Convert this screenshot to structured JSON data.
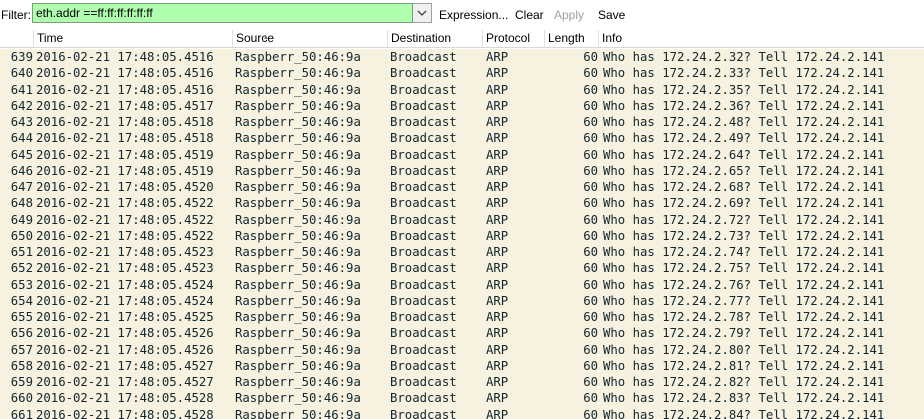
{
  "toolbar": {
    "filter_label": "Filter:",
    "filter_value": "eth.addr ==ff:ff:ff:ff:ff:ff",
    "expression_label": "Expression...",
    "clear_label": "Clear",
    "apply_label": "Apply",
    "save_label": "Save"
  },
  "columns": {
    "no": "",
    "time": "Time",
    "source": "Source",
    "destination": "Destination",
    "protocol": "Protocol",
    "length": "Length",
    "info": "Info"
  },
  "colors": {
    "filter_valid_bg": "#afffaf",
    "row_bg": "#f7f1df",
    "row_text": "#12272e"
  },
  "packets": [
    {
      "no": "639",
      "time": "2016-02-21 17:48:05.4516",
      "source": "Raspberr_50:46:9a",
      "destination": "Broadcast",
      "protocol": "ARP",
      "length": "60",
      "info": "Who has 172.24.2.32?  Tell 172.24.2.141"
    },
    {
      "no": "640",
      "time": "2016-02-21 17:48:05.4516",
      "source": "Raspberr_50:46:9a",
      "destination": "Broadcast",
      "protocol": "ARP",
      "length": "60",
      "info": "Who has 172.24.2.33?  Tell 172.24.2.141"
    },
    {
      "no": "641",
      "time": "2016-02-21 17:48:05.4516",
      "source": "Raspberr_50:46:9a",
      "destination": "Broadcast",
      "protocol": "ARP",
      "length": "60",
      "info": "Who has 172.24.2.35?  Tell 172.24.2.141"
    },
    {
      "no": "642",
      "time": "2016-02-21 17:48:05.4517",
      "source": "Raspberr_50:46:9a",
      "destination": "Broadcast",
      "protocol": "ARP",
      "length": "60",
      "info": "Who has 172.24.2.36?  Tell 172.24.2.141"
    },
    {
      "no": "643",
      "time": "2016-02-21 17:48:05.4518",
      "source": "Raspberr_50:46:9a",
      "destination": "Broadcast",
      "protocol": "ARP",
      "length": "60",
      "info": "Who has 172.24.2.48?  Tell 172.24.2.141"
    },
    {
      "no": "644",
      "time": "2016-02-21 17:48:05.4518",
      "source": "Raspberr_50:46:9a",
      "destination": "Broadcast",
      "protocol": "ARP",
      "length": "60",
      "info": "Who has 172.24.2.49?  Tell 172.24.2.141"
    },
    {
      "no": "645",
      "time": "2016-02-21 17:48:05.4519",
      "source": "Raspberr_50:46:9a",
      "destination": "Broadcast",
      "protocol": "ARP",
      "length": "60",
      "info": "Who has 172.24.2.64?  Tell 172.24.2.141"
    },
    {
      "no": "646",
      "time": "2016-02-21 17:48:05.4519",
      "source": "Raspberr_50:46:9a",
      "destination": "Broadcast",
      "protocol": "ARP",
      "length": "60",
      "info": "Who has 172.24.2.65?  Tell 172.24.2.141"
    },
    {
      "no": "647",
      "time": "2016-02-21 17:48:05.4520",
      "source": "Raspberr_50:46:9a",
      "destination": "Broadcast",
      "protocol": "ARP",
      "length": "60",
      "info": "Who has 172.24.2.68?  Tell 172.24.2.141"
    },
    {
      "no": "648",
      "time": "2016-02-21 17:48:05.4522",
      "source": "Raspberr_50:46:9a",
      "destination": "Broadcast",
      "protocol": "ARP",
      "length": "60",
      "info": "Who has 172.24.2.69?  Tell 172.24.2.141"
    },
    {
      "no": "649",
      "time": "2016-02-21 17:48:05.4522",
      "source": "Raspberr_50:46:9a",
      "destination": "Broadcast",
      "protocol": "ARP",
      "length": "60",
      "info": "Who has 172.24.2.72?  Tell 172.24.2.141"
    },
    {
      "no": "650",
      "time": "2016-02-21 17:48:05.4522",
      "source": "Raspberr_50:46:9a",
      "destination": "Broadcast",
      "protocol": "ARP",
      "length": "60",
      "info": "Who has 172.24.2.73?  Tell 172.24.2.141"
    },
    {
      "no": "651",
      "time": "2016-02-21 17:48:05.4523",
      "source": "Raspberr_50:46:9a",
      "destination": "Broadcast",
      "protocol": "ARP",
      "length": "60",
      "info": "Who has 172.24.2.74?  Tell 172.24.2.141"
    },
    {
      "no": "652",
      "time": "2016-02-21 17:48:05.4523",
      "source": "Raspberr_50:46:9a",
      "destination": "Broadcast",
      "protocol": "ARP",
      "length": "60",
      "info": "Who has 172.24.2.75?  Tell 172.24.2.141"
    },
    {
      "no": "653",
      "time": "2016-02-21 17:48:05.4524",
      "source": "Raspberr_50:46:9a",
      "destination": "Broadcast",
      "protocol": "ARP",
      "length": "60",
      "info": "Who has 172.24.2.76?  Tell 172.24.2.141"
    },
    {
      "no": "654",
      "time": "2016-02-21 17:48:05.4524",
      "source": "Raspberr_50:46:9a",
      "destination": "Broadcast",
      "protocol": "ARP",
      "length": "60",
      "info": "Who has 172.24.2.77?  Tell 172.24.2.141"
    },
    {
      "no": "655",
      "time": "2016-02-21 17:48:05.4525",
      "source": "Raspberr_50:46:9a",
      "destination": "Broadcast",
      "protocol": "ARP",
      "length": "60",
      "info": "Who has 172.24.2.78?  Tell 172.24.2.141"
    },
    {
      "no": "656",
      "time": "2016-02-21 17:48:05.4526",
      "source": "Raspberr_50:46:9a",
      "destination": "Broadcast",
      "protocol": "ARP",
      "length": "60",
      "info": "Who has 172.24.2.79?  Tell 172.24.2.141"
    },
    {
      "no": "657",
      "time": "2016-02-21 17:48:05.4526",
      "source": "Raspberr_50:46:9a",
      "destination": "Broadcast",
      "protocol": "ARP",
      "length": "60",
      "info": "Who has 172.24.2.80?  Tell 172.24.2.141"
    },
    {
      "no": "658",
      "time": "2016-02-21 17:48:05.4527",
      "source": "Raspberr_50:46:9a",
      "destination": "Broadcast",
      "protocol": "ARP",
      "length": "60",
      "info": "Who has 172.24.2.81?  Tell 172.24.2.141"
    },
    {
      "no": "659",
      "time": "2016-02-21 17:48:05.4527",
      "source": "Raspberr_50:46:9a",
      "destination": "Broadcast",
      "protocol": "ARP",
      "length": "60",
      "info": "Who has 172.24.2.82?  Tell 172.24.2.141"
    },
    {
      "no": "660",
      "time": "2016-02-21 17:48:05.4528",
      "source": "Raspberr_50:46:9a",
      "destination": "Broadcast",
      "protocol": "ARP",
      "length": "60",
      "info": "Who has 172.24.2.83?  Tell 172.24.2.141"
    },
    {
      "no": "661",
      "time": "2016-02-21 17:48:05.4528",
      "source": "Raspberr_50:46:9a",
      "destination": "Broadcast",
      "protocol": "ARP",
      "length": "60",
      "info": "Who has 172.24.2.84?  Tell 172.24.2.141"
    }
  ]
}
